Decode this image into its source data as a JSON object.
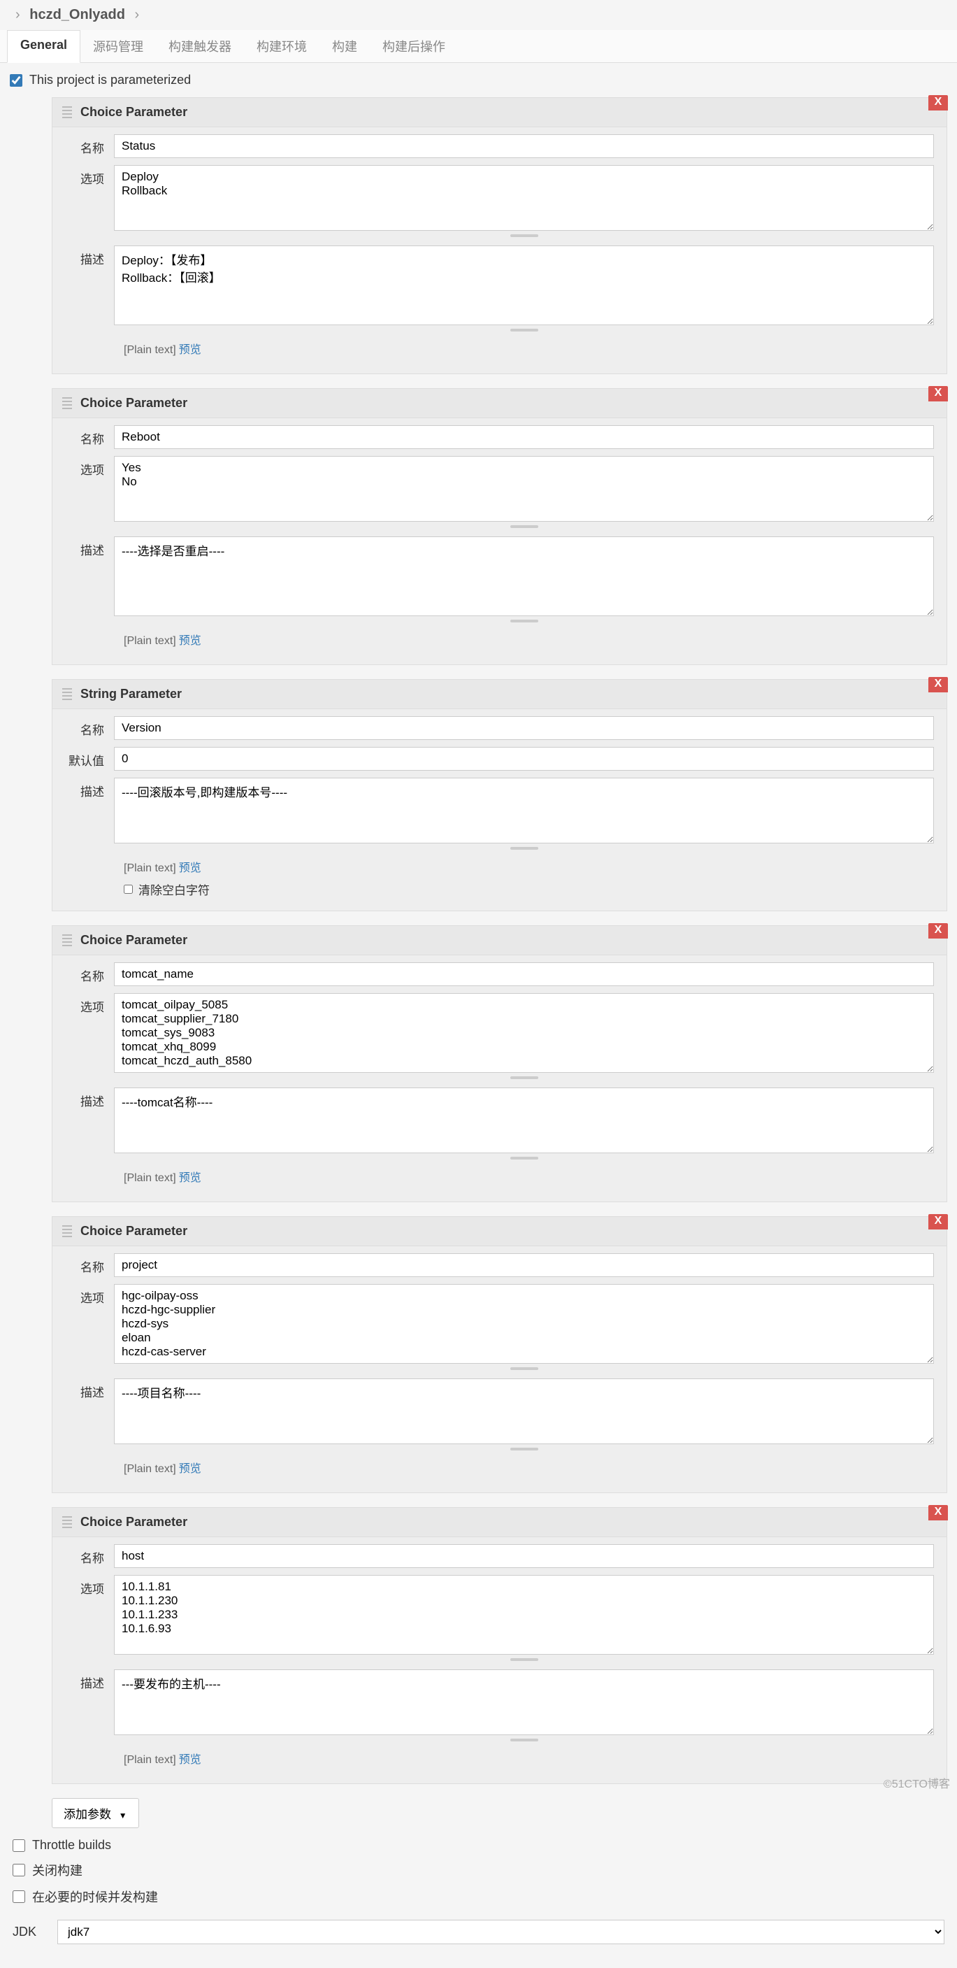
{
  "breadcrumb": {
    "name": "hczd_Onlyadd"
  },
  "tabs": [
    "General",
    "源码管理",
    "构建触发器",
    "构建环境",
    "构建",
    "构建后操作"
  ],
  "activeTab": 0,
  "parameterized": {
    "checked": true,
    "label": "This project is parameterized"
  },
  "labels": {
    "name": "名称",
    "choices": "选项",
    "description": "描述",
    "default": "默认值",
    "plaintext": "[Plain text]",
    "preview": "预览",
    "trim": "清除空白字符",
    "addParam": "添加参数"
  },
  "params": [
    {
      "type": "Choice Parameter",
      "name": "Status",
      "choices": "Deploy\nRollback",
      "choicesRows": 4,
      "description": "Deploy：【发布】\nRollback：【回滚】",
      "descRows": 5
    },
    {
      "type": "Choice Parameter",
      "name": "Reboot",
      "choices": "Yes\nNo",
      "choicesRows": 4,
      "description": "----选择是否重启----",
      "descRows": 5
    },
    {
      "type": "String Parameter",
      "name": "Version",
      "default": "0",
      "description": "----回滚版本号,即构建版本号----",
      "descRows": 4,
      "trim": false
    },
    {
      "type": "Choice Parameter",
      "name": "tomcat_name",
      "choices": "tomcat_oilpay_5085\ntomcat_supplier_7180\ntomcat_sys_9083\ntomcat_xhq_8099\ntomcat_hczd_auth_8580",
      "choicesRows": 5,
      "description": "----tomcat名称----",
      "descRows": 4
    },
    {
      "type": "Choice Parameter",
      "name": "project",
      "choices": "hgc-oilpay-oss\nhczd-hgc-supplier\nhczd-sys\neloan\nhczd-cas-server",
      "choicesRows": 5,
      "description": "----项目名称----",
      "descRows": 4
    },
    {
      "type": "Choice Parameter",
      "name": "host",
      "choices": "10.1.1.81\n10.1.1.230\n10.1.1.233\n10.1.6.93",
      "choicesRows": 5,
      "description": "---要发布的主机----",
      "descRows": 4
    }
  ],
  "bottomChecks": [
    {
      "label": "Throttle builds",
      "checked": false
    },
    {
      "label": "关闭构建",
      "checked": false
    },
    {
      "label": "在必要的时候并发构建",
      "checked": false
    }
  ],
  "jdk": {
    "label": "JDK",
    "value": "jdk7"
  },
  "watermark": "©51CTO博客"
}
